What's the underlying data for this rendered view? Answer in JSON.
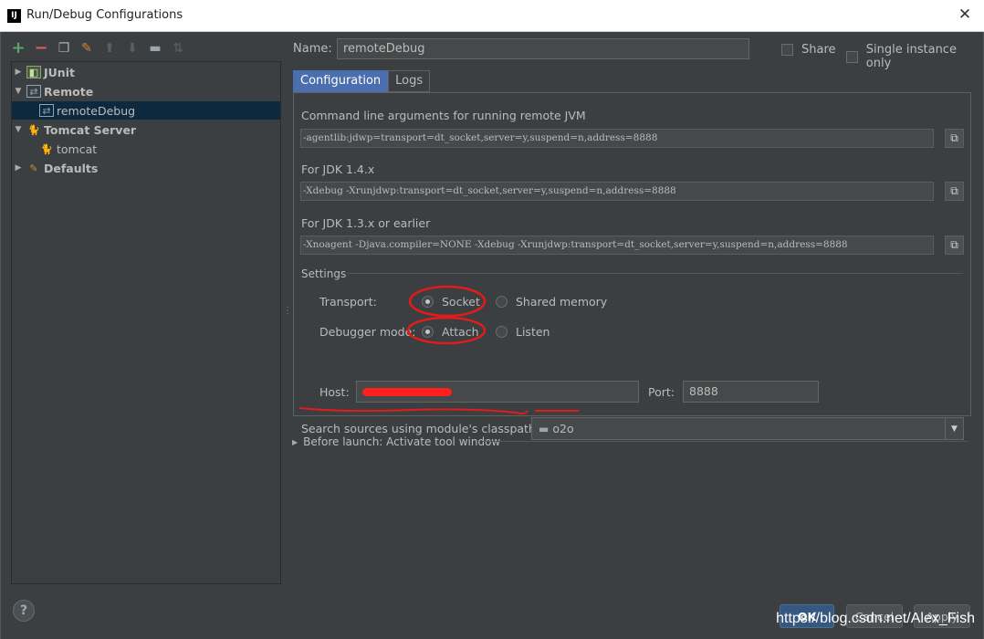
{
  "window": {
    "title": "Run/Debug Configurations",
    "app_icon": "IJ"
  },
  "toolbar": {
    "icons": [
      "add-icon",
      "remove-icon",
      "copy-icon",
      "edit-defaults-icon",
      "move-up-icon",
      "move-down-icon",
      "folder-icon",
      "sort-icon"
    ]
  },
  "tree": {
    "items": [
      {
        "label": "JUnit",
        "level": 0,
        "expanded": false
      },
      {
        "label": "Remote",
        "level": 0,
        "expanded": true
      },
      {
        "label": "remoteDebug",
        "level": 1,
        "selected": true
      },
      {
        "label": "Tomcat Server",
        "level": 0,
        "expanded": true
      },
      {
        "label": "tomcat",
        "level": 1
      },
      {
        "label": "Defaults",
        "level": 0,
        "expanded": false
      }
    ]
  },
  "form": {
    "name_label": "Name:",
    "name_value": "remoteDebug",
    "share_label": "Share",
    "single_instance_label": "Single instance only"
  },
  "tabs": [
    {
      "label": "Configuration",
      "active": true
    },
    {
      "label": "Logs",
      "active": false
    }
  ],
  "config": {
    "cmd_label": "Command line arguments for running remote JVM",
    "cmd_value": "-agentlib:jdwp=transport=dt_socket,server=y,suspend=n,address=8888",
    "jdk14_label": "For JDK 1.4.x",
    "jdk14_value": "-Xdebug -Xrunjdwp:transport=dt_socket,server=y,suspend=n,address=8888",
    "jdk13_label": "For JDK 1.3.x or earlier",
    "jdk13_value": "-Xnoagent -Djava.compiler=NONE -Xdebug -Xrunjdwp:transport=dt_socket,server=y,suspend=n,address=8888",
    "settings_label": "Settings",
    "transport_label": "Transport:",
    "transport_options": [
      "Socket",
      "Shared memory"
    ],
    "transport_selected": "Socket",
    "debugger_mode_label": "Debugger mode:",
    "debugger_mode_options": [
      "Attach",
      "Listen"
    ],
    "debugger_mode_selected": "Attach",
    "host_label": "Host:",
    "port_label": "Port:",
    "port_value": "8888",
    "classpath_label": "Search sources using module's classpath:",
    "module_value": "o2o"
  },
  "before_launch": {
    "label": "Before launch: Activate tool window"
  },
  "buttons": {
    "ok": "OK",
    "cancel": "Cancel",
    "apply": "Apply",
    "help": "?"
  },
  "watermark": "https://blog.csdn.net/Alex_Fish",
  "colors": {
    "accent_tab": "#4b6eaf",
    "selection": "#0d293e",
    "annotation_red": "#ff1f1f",
    "background": "#3c3f41"
  }
}
